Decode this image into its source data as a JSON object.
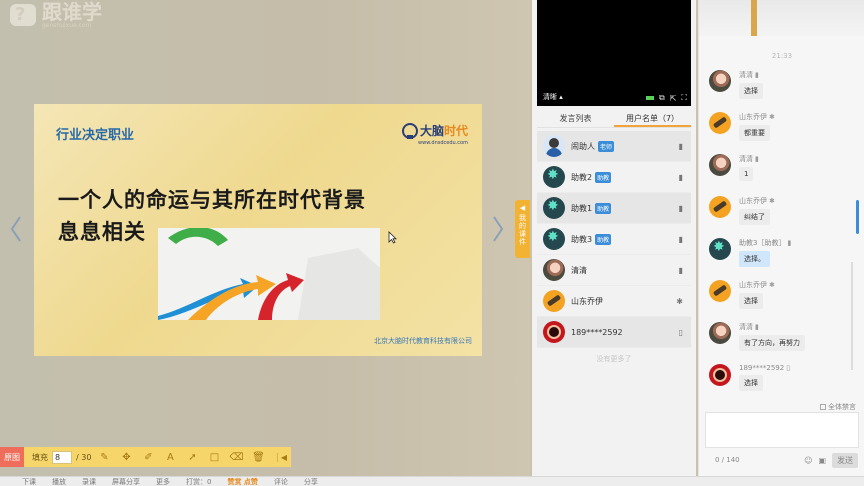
{
  "watermark": {
    "name": "跟谁学",
    "url": "genshuixue.com"
  },
  "slide": {
    "heading": "行业决定职业",
    "logo_text_1": "大脑",
    "logo_text_2": "时代",
    "logo_url": "www.dnsdcedu.com",
    "line1": "一个人的命运与其所在时代背景",
    "line2": "息息相关",
    "footer": "北京大脑时代教育科技有限公司"
  },
  "side_tab": {
    "label": "我的课件"
  },
  "toolbar": {
    "original_label": "原图",
    "fill_label": "填充",
    "page_current": "8",
    "page_total": "/ 30",
    "tools": [
      "pen-icon",
      "move-icon",
      "marker-icon",
      "text-icon",
      "arrow-icon",
      "rect-icon",
      "eraser-icon",
      "trash-icon"
    ]
  },
  "video": {
    "quality": "清晰 ▴"
  },
  "tabs": {
    "speakers": "发言列表",
    "users": "用户名单（7）"
  },
  "users": [
    {
      "name": "闹助人",
      "badge": "老师",
      "avatar": "av-hanzi",
      "device": "▮"
    },
    {
      "name": "助教2",
      "badge": "助教",
      "avatar": "av-gear",
      "device": "▮"
    },
    {
      "name": "助教1",
      "badge": "助教",
      "avatar": "av-gear",
      "device": "▮"
    },
    {
      "name": "助教3",
      "badge": "助教",
      "avatar": "av-gear",
      "device": "▮"
    },
    {
      "name": "清清",
      "badge": "",
      "avatar": "av-photo",
      "device": "▮"
    },
    {
      "name": "山东乔伊",
      "badge": "",
      "avatar": "av-scope",
      "device": "✱"
    },
    {
      "name": "189****2592",
      "badge": "",
      "avatar": "av-red",
      "device": "▯"
    }
  ],
  "no_more": "没有更多了",
  "chat": {
    "time": "21:33",
    "messages": [
      {
        "name": "清清",
        "tag": "▮",
        "text": "选择",
        "avatar": "av-photo"
      },
      {
        "name": "山东乔伊",
        "tag": "✱",
        "text": "都重要",
        "avatar": "av-scope"
      },
      {
        "name": "清清",
        "tag": "▮",
        "text": "1",
        "avatar": "av-photo"
      },
      {
        "name": "山东乔伊",
        "tag": "✱",
        "text": "纠结了",
        "avatar": "av-scope"
      },
      {
        "name": "助教3［助教］",
        "tag": "▮",
        "text": "选择。",
        "avatar": "av-gear",
        "blue": true
      },
      {
        "name": "山东乔伊",
        "tag": "✱",
        "text": "选择",
        "avatar": "av-scope"
      },
      {
        "name": "清清",
        "tag": "▮",
        "text": "有了方向，再努力",
        "avatar": "av-photo"
      },
      {
        "name": "189****2592",
        "tag": "▯",
        "text": "选择",
        "avatar": "av-red"
      }
    ],
    "gag_label": "全体禁言",
    "count": "0 / 140",
    "send": "发送"
  },
  "bottom": {
    "items": [
      "下课",
      "播放",
      "录课",
      "屏幕分享",
      "更多",
      "打赏：0",
      "赞赏 点赞",
      "评论",
      "分享"
    ]
  }
}
